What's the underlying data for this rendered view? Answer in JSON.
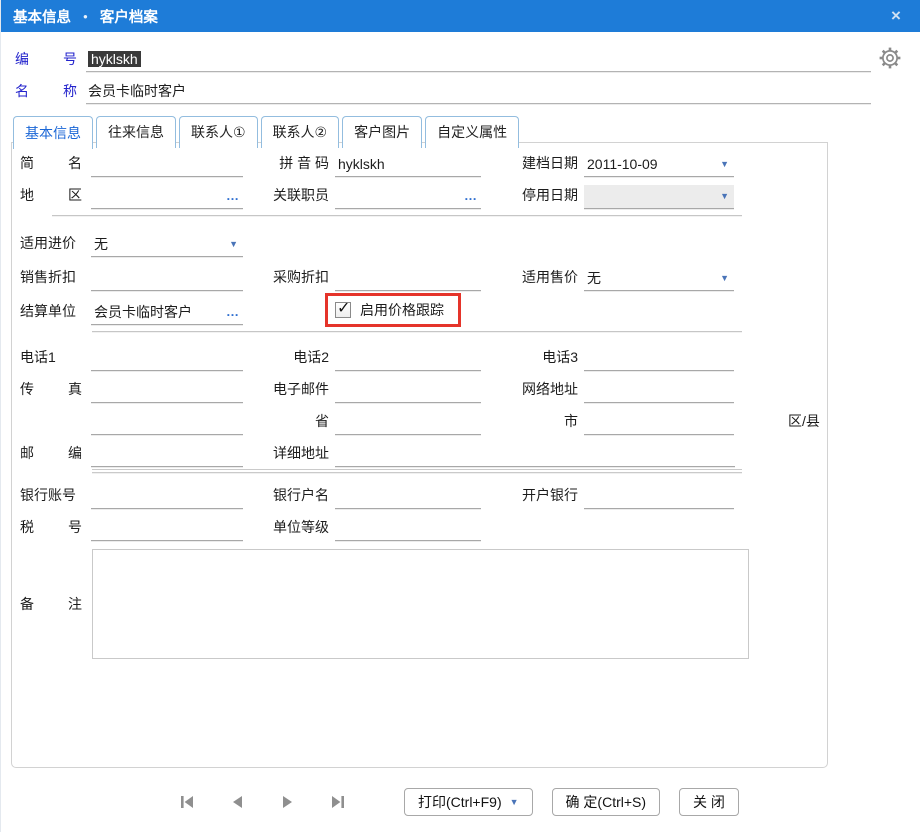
{
  "window": {
    "title_left": "基本信息",
    "title_right": "客户档案",
    "title_bullet": "●",
    "close_icon": "×"
  },
  "colors": {
    "titlebar_blue": "#1e7cd8",
    "label_blue": "#2323cc",
    "active_tab_blue": "#1a66d6",
    "highlight_red": "#e5342a",
    "selection_bg": "#3a3a3a"
  },
  "icons": {
    "dropdown": "▼",
    "ellipsis": "…",
    "check": "✓",
    "gear": "settings-gear"
  },
  "header": {
    "code": {
      "label": "编号",
      "value": "hyklskh"
    },
    "name": {
      "label": "名称",
      "value": "会员卡临时客户"
    }
  },
  "tabs": [
    {
      "label": "基本信息",
      "active": true
    },
    {
      "label": "往来信息",
      "active": false
    },
    {
      "label": "联系人①",
      "active": false
    },
    {
      "label": "联系人②",
      "active": false
    },
    {
      "label": "客户图片",
      "active": false
    },
    {
      "label": "自定义属性",
      "active": false
    }
  ],
  "fields": {
    "short_name": {
      "label": "简名",
      "value": ""
    },
    "pinyin": {
      "label": "拼 音 码",
      "value": "hyklskh"
    },
    "create_date": {
      "label": "建档日期",
      "value": "2011-10-09"
    },
    "region": {
      "label": "地区",
      "value": ""
    },
    "linked_staff": {
      "label": "关联职员",
      "value": ""
    },
    "disable_date": {
      "label": "停用日期",
      "value": ""
    },
    "purchase_price_type": {
      "label": "适用进价",
      "value": "无"
    },
    "sales_discount": {
      "label": "销售折扣",
      "value": ""
    },
    "purchase_discount": {
      "label": "采购折扣",
      "value": ""
    },
    "sale_price_type": {
      "label": "适用售价",
      "value": "无"
    },
    "settlement_unit": {
      "label": "结算单位",
      "value": "会员卡临时客户"
    },
    "price_tracking": {
      "label": "启用价格跟踪",
      "checked": true
    },
    "phone1": {
      "label": "电话1",
      "value": ""
    },
    "phone2": {
      "label": "电话2",
      "value": ""
    },
    "phone3": {
      "label": "电话3",
      "value": ""
    },
    "fax": {
      "label": "传真",
      "value": ""
    },
    "email": {
      "label": "电子邮件",
      "value": ""
    },
    "website": {
      "label": "网络地址",
      "value": ""
    },
    "extra_region": {
      "label": "",
      "value": ""
    },
    "province": {
      "label": "省",
      "value": ""
    },
    "city": {
      "label": "市",
      "value": ""
    },
    "district": {
      "label": "区/县"
    },
    "zipcode": {
      "label": "邮编",
      "value": ""
    },
    "address": {
      "label": "详细地址",
      "value": ""
    },
    "bank_account": {
      "label": "银行账号",
      "value": ""
    },
    "bank_holder": {
      "label": "银行户名",
      "value": ""
    },
    "bank_name": {
      "label": "开户银行",
      "value": ""
    },
    "tax_no": {
      "label": "税号",
      "value": ""
    },
    "unit_level": {
      "label": "单位等级",
      "value": ""
    },
    "remark": {
      "label": "备注",
      "value": ""
    }
  },
  "footer": {
    "print_button": "打印(Ctrl+F9)",
    "ok_button": "确 定(Ctrl+S)",
    "close_button": "关 闭"
  }
}
